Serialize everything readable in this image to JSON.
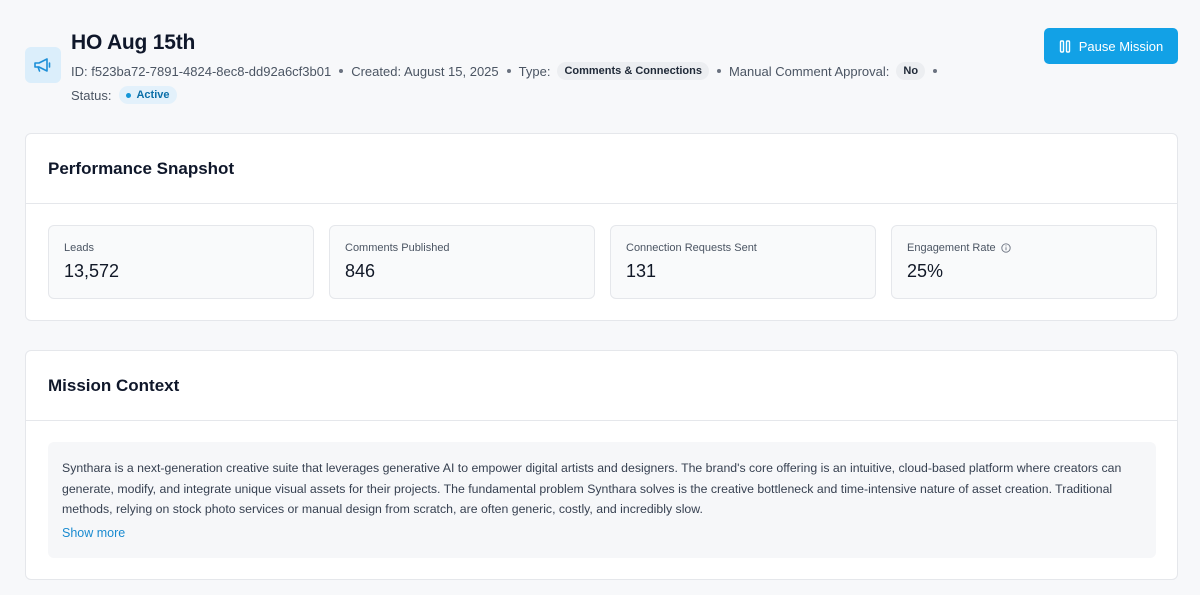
{
  "header": {
    "title": "HO Aug 15th",
    "id_text": "ID: f523ba72-7891-4824-8ec8-dd92a6cf3b01",
    "created_text": "Created: August 15, 2025",
    "type_label": "Type:",
    "type_value": "Comments & Connections",
    "approval_label": "Manual Comment Approval:",
    "approval_value": "No",
    "status_label": "Status:",
    "status_value": "Active",
    "pause_label": "Pause Mission"
  },
  "performance": {
    "title": "Performance Snapshot",
    "stats": [
      {
        "label": "Leads",
        "value": "13,572"
      },
      {
        "label": "Comments Published",
        "value": "846"
      },
      {
        "label": "Connection Requests Sent",
        "value": "131"
      },
      {
        "label": "Engagement Rate",
        "value": "25%"
      }
    ]
  },
  "context": {
    "title": "Mission Context",
    "text": "Synthara is a next-generation creative suite that leverages generative AI to empower digital artists and designers. The brand's core offering is an intuitive, cloud-based platform where creators can generate, modify, and integrate unique visual assets for their projects. The fundamental problem Synthara solves is the creative bottleneck and time-intensive nature of asset creation. Traditional methods, relying on stock photo services or manual design from scratch, are often generic, costly, and incredibly slow.",
    "show_more": "Show more"
  },
  "colors": {
    "accent": "#12a1e6",
    "active_badge_bg": "#e3f1fb",
    "active_badge_text": "#0b6fa8",
    "link": "#1a8bd0"
  },
  "icons": {
    "mission": "megaphone-icon",
    "pause": "pause-icon",
    "info": "info-icon"
  }
}
